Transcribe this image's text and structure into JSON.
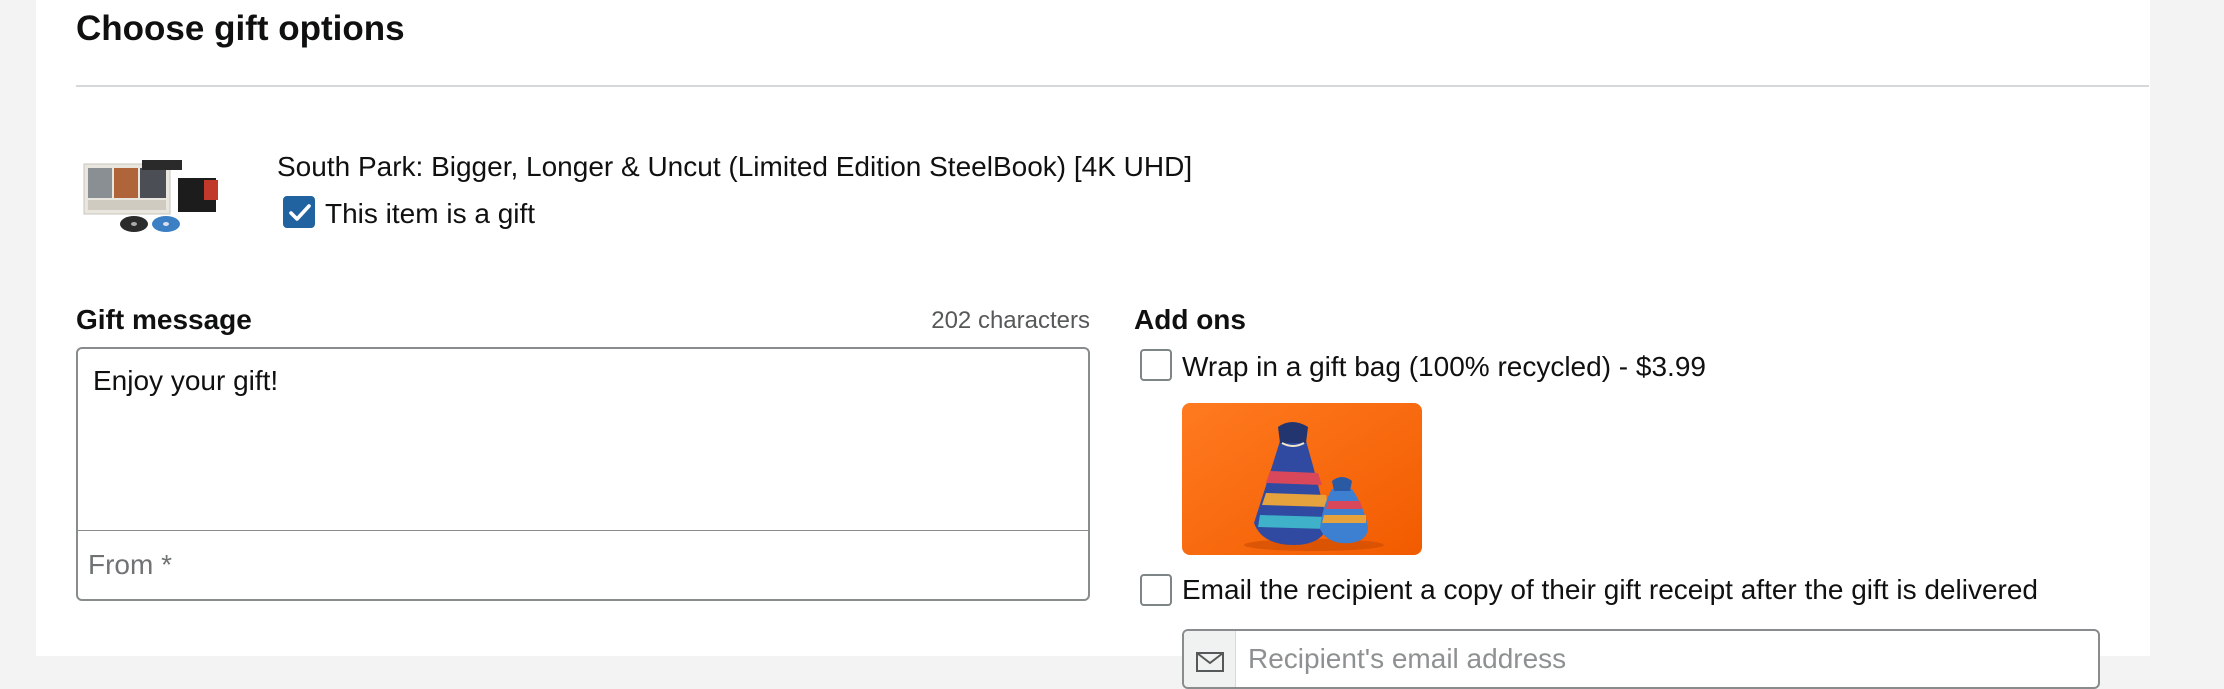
{
  "page": {
    "title": "Choose gift options"
  },
  "item": {
    "product_title": "South Park: Bigger, Longer & Uncut (Limited Edition SteelBook) [4K UHD]",
    "is_gift_label": "This item is a gift",
    "is_gift_checked": true,
    "thumbnail_icon": "product-thumbnail-icon"
  },
  "gift_message": {
    "label": "Gift message",
    "characters_remaining": "202 characters",
    "message_value": "Enjoy your gift!",
    "from_placeholder": "From *",
    "from_value": ""
  },
  "add_ons": {
    "label": "Add ons",
    "gift_bag": {
      "label": "Wrap in a gift bag (100% recycled) - $3.99",
      "checked": false,
      "image_icon": "gift-bag-image"
    },
    "email_receipt": {
      "label": "Email the recipient a copy of their gift receipt after the gift is delivered",
      "checked": false,
      "email_placeholder": "Recipient's email address"
    }
  },
  "colors": {
    "checkbox_checked": "#2162a1",
    "gift_bag_background": "#ff6a13",
    "divider": "#d5d9d9"
  }
}
